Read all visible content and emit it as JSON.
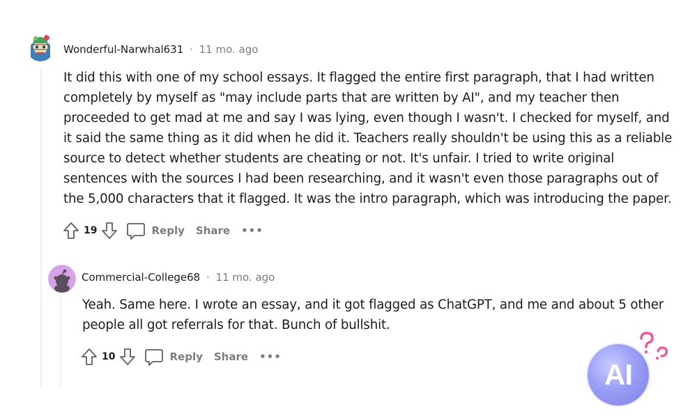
{
  "comments": [
    {
      "username": "Wonderful-Narwhal631",
      "separator": "·",
      "time": "11 mo. ago",
      "lines": [
        "It did this with one of my school essays. It flagged the entire first paragraph, that I had written",
        "completely by myself as \"may include parts that are written by AI\", and my teacher then",
        "proceeded to get mad at me and say I was lying, even though I wasn't. I checked for myself, and",
        "it said the same thing as it did when he did it. Teachers really shouldn't be using this as a reliable",
        "source to detect whether students are cheating or not. It's unfair. I tried to write original",
        "sentences with the sources I had been researching, and it wasn't even those paragraphs out of",
        "the 5,000 characters that it flagged. It was the intro paragraph, which was introducing the paper."
      ],
      "score": "19",
      "reply_label": "Reply",
      "share_label": "Share",
      "more_label": "•••"
    },
    {
      "username": "Commercial-College68",
      "separator": "·",
      "time": "11 mo. ago",
      "lines": [
        "Yeah. Same here. I wrote an essay, and it got flagged as ChatGPT, and me and about 5 other",
        "people all got referrals for that. Bunch of bullshit."
      ],
      "score": "10",
      "reply_label": "Reply",
      "share_label": "Share",
      "more_label": "•••"
    }
  ],
  "badge": {
    "label": "AI",
    "colors": {
      "circle": "#9a9ef5",
      "question_marks": "#f0529a"
    }
  }
}
